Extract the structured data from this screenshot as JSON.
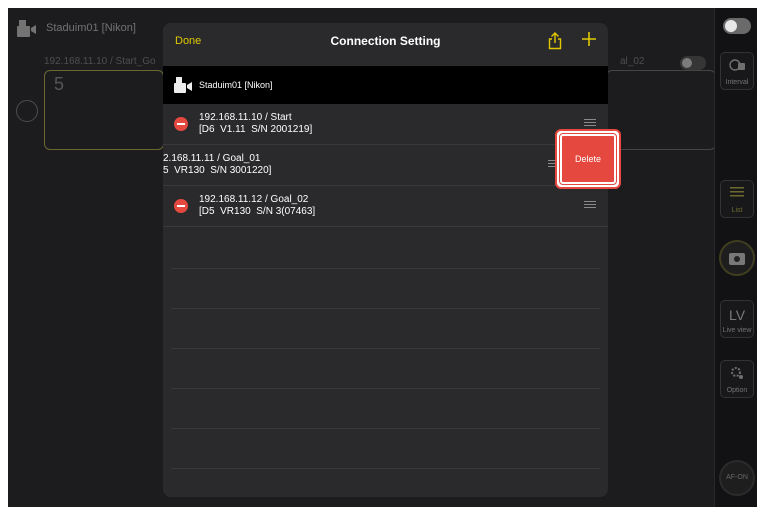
{
  "background": {
    "title": "Staduim01 [Nikon]",
    "subtitle_left": "192.168.11.10 / Start_Go",
    "subtitle_right": "al_02",
    "digit": "5"
  },
  "sidebar": {
    "interval_label": "Interval",
    "list_label": "List",
    "lv_label": "LV",
    "live_view_label": "Live view",
    "option_label": "Option",
    "af_on_label": "AF-ON"
  },
  "modal": {
    "done_label": "Done",
    "title": "Connection Setting",
    "share_icon": "share-icon",
    "add_icon": "plus-icon",
    "group_label": "Staduim01 [Nikon]",
    "rows": [
      {
        "line1": "192.168.11.10 / Start",
        "line2": "[D6  V1.11  S/N 2001219]"
      },
      {
        "line1": "2.168.11.11 / Goal_01",
        "line2": "5  VR130  S/N 3001220]"
      },
      {
        "line1": "192.168.11.12 / Goal_02",
        "line2": "[D5  VR130  S/N 3(07463]"
      }
    ],
    "delete_label": "Delete"
  },
  "colors": {
    "accent_yellow": "#e0c900",
    "delete_red": "#e5483e",
    "modal_bg": "#2a2a2c",
    "screen_bg": "#1c1c1e"
  }
}
